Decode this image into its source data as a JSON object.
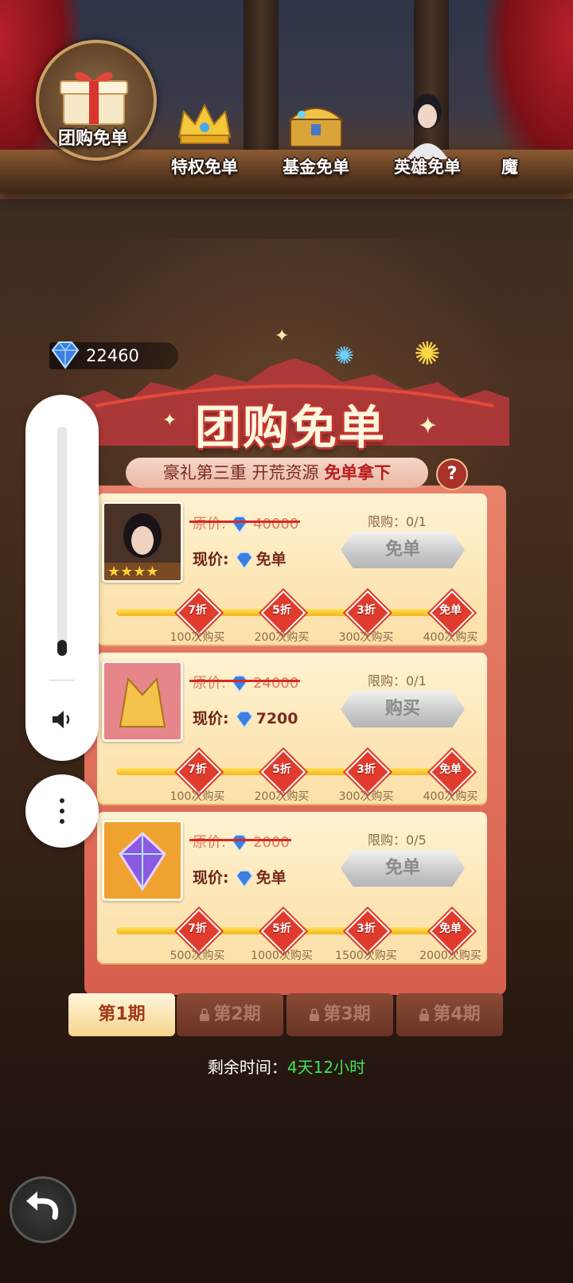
{
  "top_tabs": [
    {
      "label": "团购免单",
      "active": true,
      "icon": "gift-box-icon"
    },
    {
      "label": "特权免单",
      "active": false,
      "icon": "crown-icon"
    },
    {
      "label": "基金免单",
      "active": false,
      "icon": "treasure-chest-icon"
    },
    {
      "label": "英雄免单",
      "active": false,
      "icon": "hero-portrait-icon"
    },
    {
      "label": "魔",
      "active": false,
      "icon": "partial-icon"
    }
  ],
  "diamond_balance": "22460",
  "panel": {
    "title": "团购免单",
    "subtitle_prefix": "豪礼第三重 开荒资源",
    "subtitle_highlight": "免单拿下",
    "help": "?"
  },
  "labels": {
    "original_price": "原价:",
    "current_price": "现价:"
  },
  "items": [
    {
      "thumb": "hero-card-icon",
      "stars": "★★★★",
      "original_price": "40000",
      "current_price": "免单",
      "limit": "限购：0/1",
      "button": "免单",
      "milestones": [
        {
          "discount": "7折",
          "count": "100次购买"
        },
        {
          "discount": "5折",
          "count": "200次购买"
        },
        {
          "discount": "3折",
          "count": "300次购买"
        },
        {
          "discount": "免单",
          "count": "400次购买"
        }
      ]
    },
    {
      "thumb": "golden-armor-icon",
      "original_price": "24000",
      "current_price": "7200",
      "limit": "限购：0/1",
      "button": "购买",
      "milestones": [
        {
          "discount": "7折",
          "count": "100次购买"
        },
        {
          "discount": "5折",
          "count": "200次购买"
        },
        {
          "discount": "3折",
          "count": "300次购买"
        },
        {
          "discount": "免单",
          "count": "400次购买"
        }
      ]
    },
    {
      "thumb": "crystal-gem-icon",
      "original_price": "2000",
      "current_price": "免单",
      "limit": "限购：0/5",
      "button": "免单",
      "milestones": [
        {
          "discount": "7折",
          "count": "500次购买"
        },
        {
          "discount": "5折",
          "count": "1000次购买"
        },
        {
          "discount": "3折",
          "count": "1500次购买"
        },
        {
          "discount": "免单",
          "count": "2000次购买"
        }
      ]
    }
  ],
  "periods": [
    {
      "label": "第1期",
      "active": true,
      "locked": false
    },
    {
      "label": "第2期",
      "active": false,
      "locked": true
    },
    {
      "label": "第3期",
      "active": false,
      "locked": true
    },
    {
      "label": "第4期",
      "active": false,
      "locked": true
    }
  ],
  "timer": {
    "label": "剩余时间：",
    "value": "4天12小时"
  },
  "colors": {
    "accent_red": "#d75f4e",
    "timer_green": "#3fe25a",
    "card_bg": "#fde6b6"
  },
  "volume_level": 0.07
}
